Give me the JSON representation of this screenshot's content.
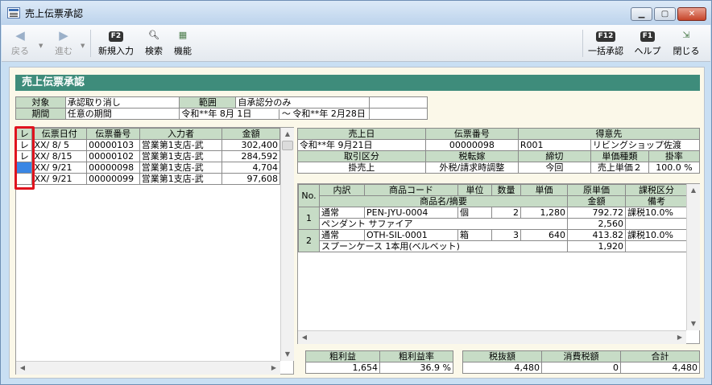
{
  "window": {
    "title": "売上伝票承認",
    "min": "▁",
    "max": "▢",
    "close": "✕"
  },
  "toolbar": {
    "back": "戻る",
    "forward": "進む",
    "new_key": "F2",
    "new": "新規入力",
    "search": "検索",
    "func": "機能",
    "bulk_key": "F12",
    "bulk": "一括承認",
    "help_key": "F1",
    "help": "ヘルプ",
    "close": "閉じる"
  },
  "header": "売上伝票承認",
  "filter": {
    "target_label": "対象",
    "target_value": "承認取り消し",
    "range_label": "範囲",
    "range_value": "自承認分のみ",
    "period_label": "期間",
    "period_type": "任意の期間",
    "period_from": "令和**年 8月 1日",
    "period_sep": "～",
    "period_to": "令和**年 2月28日"
  },
  "list": {
    "headers": [
      "レ",
      "伝票日付",
      "伝票番号",
      "入力者",
      "金額"
    ],
    "rows": [
      {
        "check": "レ",
        "date": "XX/ 8/ 5",
        "no": "00000103",
        "user": "営業第1支店-武",
        "amount": "302,400"
      },
      {
        "check": "レ",
        "date": "XX/ 8/15",
        "no": "00000102",
        "user": "営業第1支店-武",
        "amount": "284,592"
      },
      {
        "check": "",
        "date": "XX/ 9/21",
        "no": "00000098",
        "user": "営業第1支店-武",
        "amount": "4,704"
      },
      {
        "check": "",
        "date": "XX/ 9/21",
        "no": "00000099",
        "user": "営業第1支店-武",
        "amount": "97,608"
      }
    ]
  },
  "slip": {
    "h_date": "売上日",
    "h_no": "伝票番号",
    "h_customer": "得意先",
    "date": "令和**年 9月21日",
    "no": "00000098",
    "customer_code": "R001",
    "customer_name": "リビングショップ佐渡",
    "h_txn": "取引区分",
    "h_tax": "税転嫁",
    "h_close": "締切",
    "h_price_type": "単価種類",
    "h_rate": "掛率",
    "txn": "掛売上",
    "tax": "外税/請求時調整",
    "close": "今回",
    "price_type": "売上単価２",
    "rate": "100.0 %"
  },
  "detail": {
    "h_no": "No.",
    "h_kind": "内訳",
    "h_code": "商品コード",
    "h_unit": "単位",
    "h_qty": "数量",
    "h_price": "単価",
    "h_cost": "原単価",
    "h_taxkind": "課税区分",
    "h_name": "商品名/摘要",
    "h_amount": "金額",
    "h_note": "備考",
    "rows": [
      {
        "no": "1",
        "kind": "通常",
        "code": "PEN-JYU-0004",
        "unit": "個",
        "qty": "2",
        "price": "1,280",
        "cost": "792.72",
        "taxkind": "課税10.0%",
        "name": "ペンダント サファイア",
        "amount": "2,560"
      },
      {
        "no": "2",
        "kind": "通常",
        "code": "OTH-SIL-0001",
        "unit": "箱",
        "qty": "3",
        "price": "640",
        "cost": "413.82",
        "taxkind": "課税10.0%",
        "name": "スプーンケース 1本用(ベルベット)",
        "amount": "1,920"
      }
    ]
  },
  "totals": {
    "h_profit": "粗利益",
    "h_profit_rate": "粗利益率",
    "profit": "1,654",
    "profit_rate": "36.9 %",
    "h_net": "税抜額",
    "h_tax": "消費税額",
    "h_total": "合計",
    "net": "4,480",
    "tax": "0",
    "total": "4,480"
  },
  "colors": {
    "header_green": "#3e8c7b",
    "cell_header": "#c7dcc6",
    "panel_bg": "#fbf8e9",
    "highlight": "#e0141e",
    "selection": "#3a86e4"
  }
}
